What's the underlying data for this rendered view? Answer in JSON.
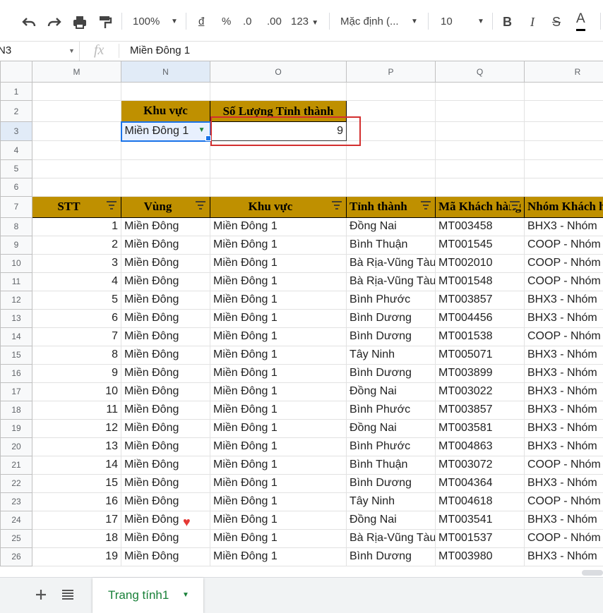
{
  "toolbar": {
    "zoom": "100%",
    "currency": "đ",
    "percent": "%",
    "dec_less": ".0",
    "dec_more": ".00",
    "number_format": "123",
    "font_name": "Mặc định (...",
    "font_size": "10",
    "bold": "B",
    "italic": "I",
    "strike": "S",
    "text_color": "A"
  },
  "formula_bar": {
    "cell_ref": "N3",
    "fx": "fx",
    "value": "Miền Đông 1"
  },
  "columns": [
    "M",
    "N",
    "O",
    "P",
    "Q",
    "R"
  ],
  "summary": {
    "header_region": "Khu vực",
    "header_count": "Số Lượng Tỉnh thành",
    "selected_region": "Miền Đông 1",
    "count": "9"
  },
  "table_headers": [
    "STT",
    "Vùng",
    "Khu vực",
    "Tỉnh thành",
    "Mã Khách hàng",
    "Nhóm Khách hàng"
  ],
  "rows": [
    [
      "1",
      "Miền Đông",
      "Miền Đông 1",
      "Đồng Nai",
      "MT003458",
      "BHX3 - Nhóm"
    ],
    [
      "2",
      "Miền Đông",
      "Miền Đông 1",
      "Bình Thuận",
      "MT001545",
      "COOP - Nhóm"
    ],
    [
      "3",
      "Miền Đông",
      "Miền Đông 1",
      "Bà Rịa-Vũng Tàu",
      "MT002010",
      "COOP - Nhóm"
    ],
    [
      "4",
      "Miền Đông",
      "Miền Đông 1",
      "Bà Rịa-Vũng Tàu",
      "MT001548",
      "COOP - Nhóm"
    ],
    [
      "5",
      "Miền Đông",
      "Miền Đông 1",
      "Bình Phước",
      "MT003857",
      "BHX3 - Nhóm"
    ],
    [
      "6",
      "Miền Đông",
      "Miền Đông 1",
      "Bình Dương",
      "MT004456",
      "BHX3 - Nhóm"
    ],
    [
      "7",
      "Miền Đông",
      "Miền Đông 1",
      "Bình Dương",
      "MT001538",
      "COOP - Nhóm"
    ],
    [
      "8",
      "Miền Đông",
      "Miền Đông 1",
      "Tây Ninh",
      "MT005071",
      "BHX3 - Nhóm"
    ],
    [
      "9",
      "Miền Đông",
      "Miền Đông 1",
      "Bình Dương",
      "MT003899",
      "BHX3 - Nhóm"
    ],
    [
      "10",
      "Miền Đông",
      "Miền Đông 1",
      "Đồng Nai",
      "MT003022",
      "BHX3 - Nhóm"
    ],
    [
      "11",
      "Miền Đông",
      "Miền Đông 1",
      "Bình Phước",
      "MT003857",
      "BHX3 - Nhóm"
    ],
    [
      "12",
      "Miền Đông",
      "Miền Đông 1",
      "Đồng Nai",
      "MT003581",
      "BHX3 - Nhóm"
    ],
    [
      "13",
      "Miền Đông",
      "Miền Đông 1",
      "Bình Phước",
      "MT004863",
      "BHX3 - Nhóm"
    ],
    [
      "14",
      "Miền Đông",
      "Miền Đông 1",
      "Bình Thuận",
      "MT003072",
      "COOP - Nhóm"
    ],
    [
      "15",
      "Miền Đông",
      "Miền Đông 1",
      "Bình Dương",
      "MT004364",
      "BHX3 - Nhóm"
    ],
    [
      "16",
      "Miền Đông",
      "Miền Đông 1",
      "Tây Ninh",
      "MT004618",
      "COOP - Nhóm"
    ],
    [
      "17",
      "Miền Đông",
      "Miền Đông 1",
      "Đồng Nai",
      "MT003541",
      "BHX3 - Nhóm"
    ],
    [
      "18",
      "Miền Đông",
      "Miền Đông 1",
      "Bà Rịa-Vũng Tàu",
      "MT001537",
      "COOP - Nhóm"
    ],
    [
      "19",
      "Miền Đông",
      "Miền Đông 1",
      "Bình Dương",
      "MT003980",
      "BHX3 - Nhóm"
    ]
  ],
  "sheet_tab": "Trang tính1",
  "colors": {
    "header_fill": "#bf9000",
    "highlight_box": "#d32f2f",
    "selection": "#1a73e8",
    "tab_text": "#188038"
  }
}
